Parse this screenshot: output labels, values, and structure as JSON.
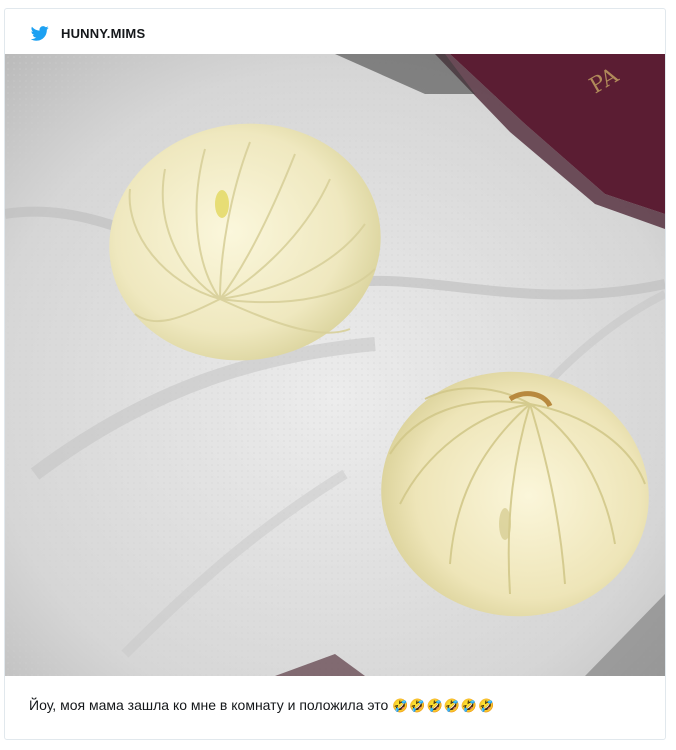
{
  "post": {
    "username": "HUNNY.MIMS",
    "caption_text": "Йоу, моя мама зашла ко мне в комнату и положила это",
    "caption_emojis": "🤣🤣🤣🤣🤣🤣",
    "image_alt": "Two halved onion slices on a white paper towel"
  },
  "icons": {
    "platform": "twitter-bird-icon"
  },
  "colors": {
    "twitter_blue": "#1da1f2",
    "card_border": "#e1e8ed",
    "text": "#14171a"
  }
}
